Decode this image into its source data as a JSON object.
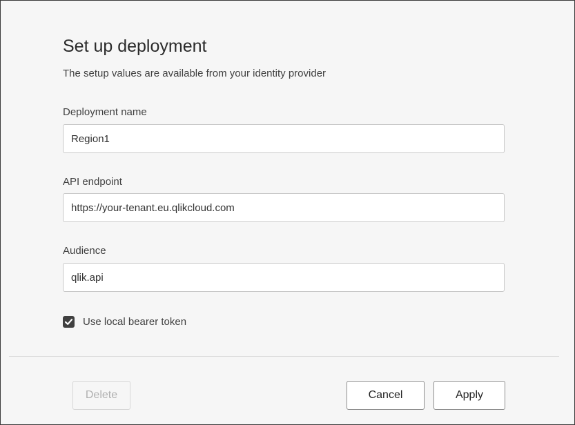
{
  "dialog": {
    "title": "Set up deployment",
    "subtitle": "The setup values are available from your identity provider"
  },
  "fields": {
    "deployment_name": {
      "label": "Deployment name",
      "value": "Region1"
    },
    "api_endpoint": {
      "label": "API endpoint",
      "value": "https://your-tenant.eu.qlikcloud.com"
    },
    "audience": {
      "label": "Audience",
      "value": "qlik.api"
    }
  },
  "options": {
    "use_local_bearer_token": {
      "label": "Use local bearer token",
      "checked": true
    }
  },
  "footer": {
    "delete_label": "Delete",
    "cancel_label": "Cancel",
    "apply_label": "Apply"
  },
  "colors": {
    "dialog_background": "#f6f6f6",
    "checkbox_fill": "#404040",
    "border": "#c8c8c8"
  },
  "icons": {
    "checkbox": "checkmark-icon"
  }
}
